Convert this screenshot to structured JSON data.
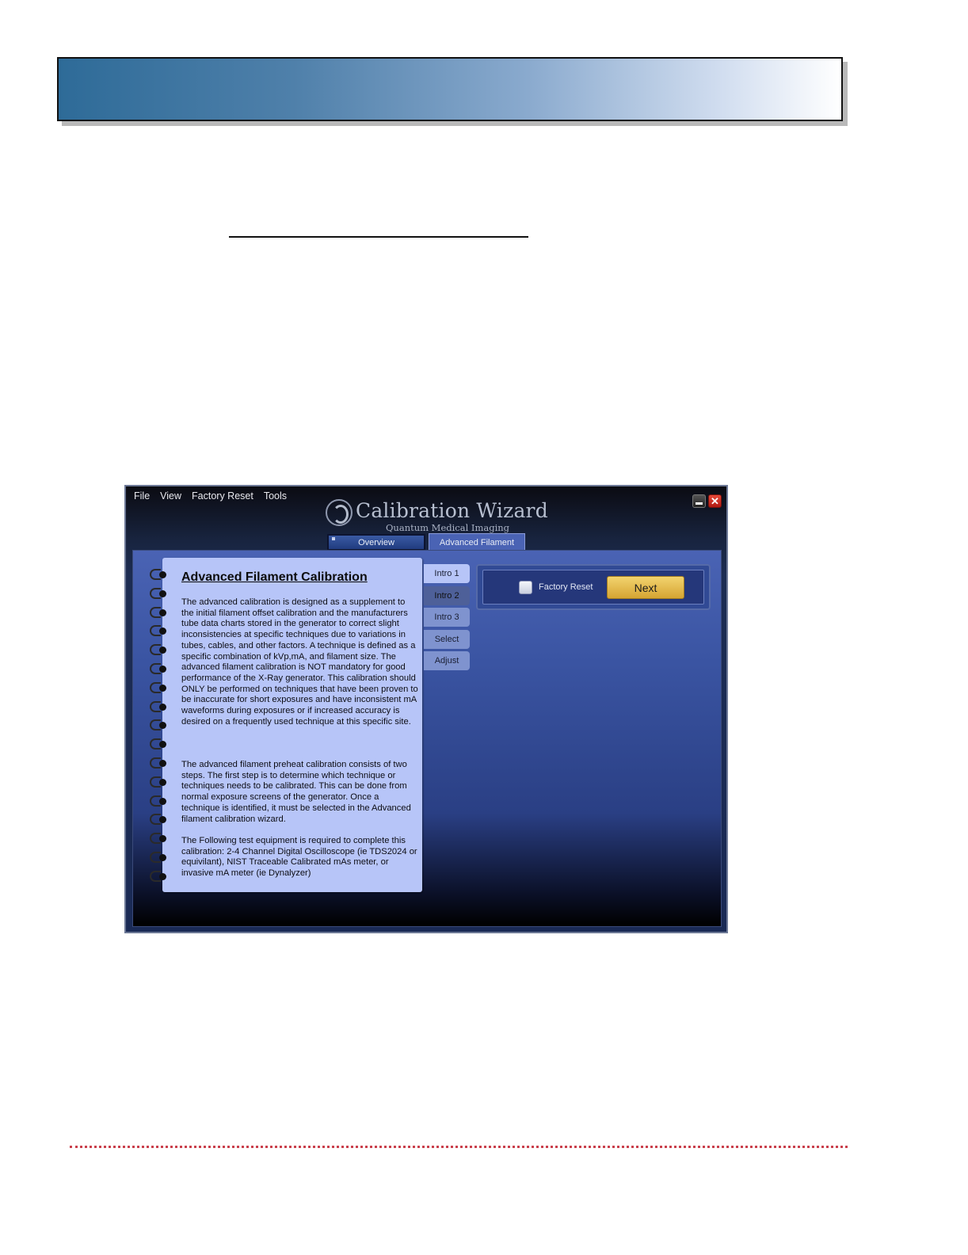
{
  "app": {
    "menu": [
      "File",
      "View",
      "Factory Reset",
      "Tools"
    ],
    "brand_title": "Calibration Wizard",
    "brand_subtitle": "Quantum Medical Imaging",
    "window_controls": {
      "minimize_icon": "minimize-icon",
      "close_icon": "close-icon",
      "close_glyph": "✕"
    },
    "tabs": [
      {
        "label": "Overview"
      },
      {
        "label": "Advanced Filament"
      }
    ],
    "notebook": {
      "heading": "Advanced Filament  Calibration",
      "paragraphs": [
        " The advanced calibration is designed as a supplement to the initial filament offset calibration and the manufacturers tube data charts stored in the generator to correct slight inconsistencies at specific techniques due to variations in tubes, cables, and other factors.  A technique is defined as a specific combination of kVp,mA, and filament size.  The advanced filament calibration is NOT mandatory for good performance of the X-Ray generator.  This calibration should ONLY be performed on techniques that have been proven to be inaccurate for short exposures and have inconsistent mA waveforms during exposures or if increased accuracy is desired on a frequently used technique at this specific site.",
        "The advanced filament preheat calibration consists of two steps.  The first step is to determine which technique or techniques needs to be calibrated.  This can be done from normal exposure screens of the generator.  Once a technique is identified, it must be selected in the Advanced filament calibration wizard.",
        "The Following test equipment is required to complete this calibration: 2-4 Channel Digital Oscilloscope (ie TDS2024 or equivilant),  NIST Traceable Calibrated mAs meter, or invasive mA meter (ie Dynalyzer)"
      ]
    },
    "steps": [
      "Intro 1",
      "Intro 2",
      "Intro 3",
      "Select",
      "Adjust"
    ],
    "active_step": "Intro 1",
    "action": {
      "checkbox_label": "Factory Reset",
      "checkbox_checked": false,
      "next_label": "Next"
    }
  },
  "colors": {
    "banner_start": "#2e6b98",
    "footer_dots": "#c9404c",
    "notebook_bg": "#b7c5f8",
    "next_button": "#e6bd4f"
  }
}
